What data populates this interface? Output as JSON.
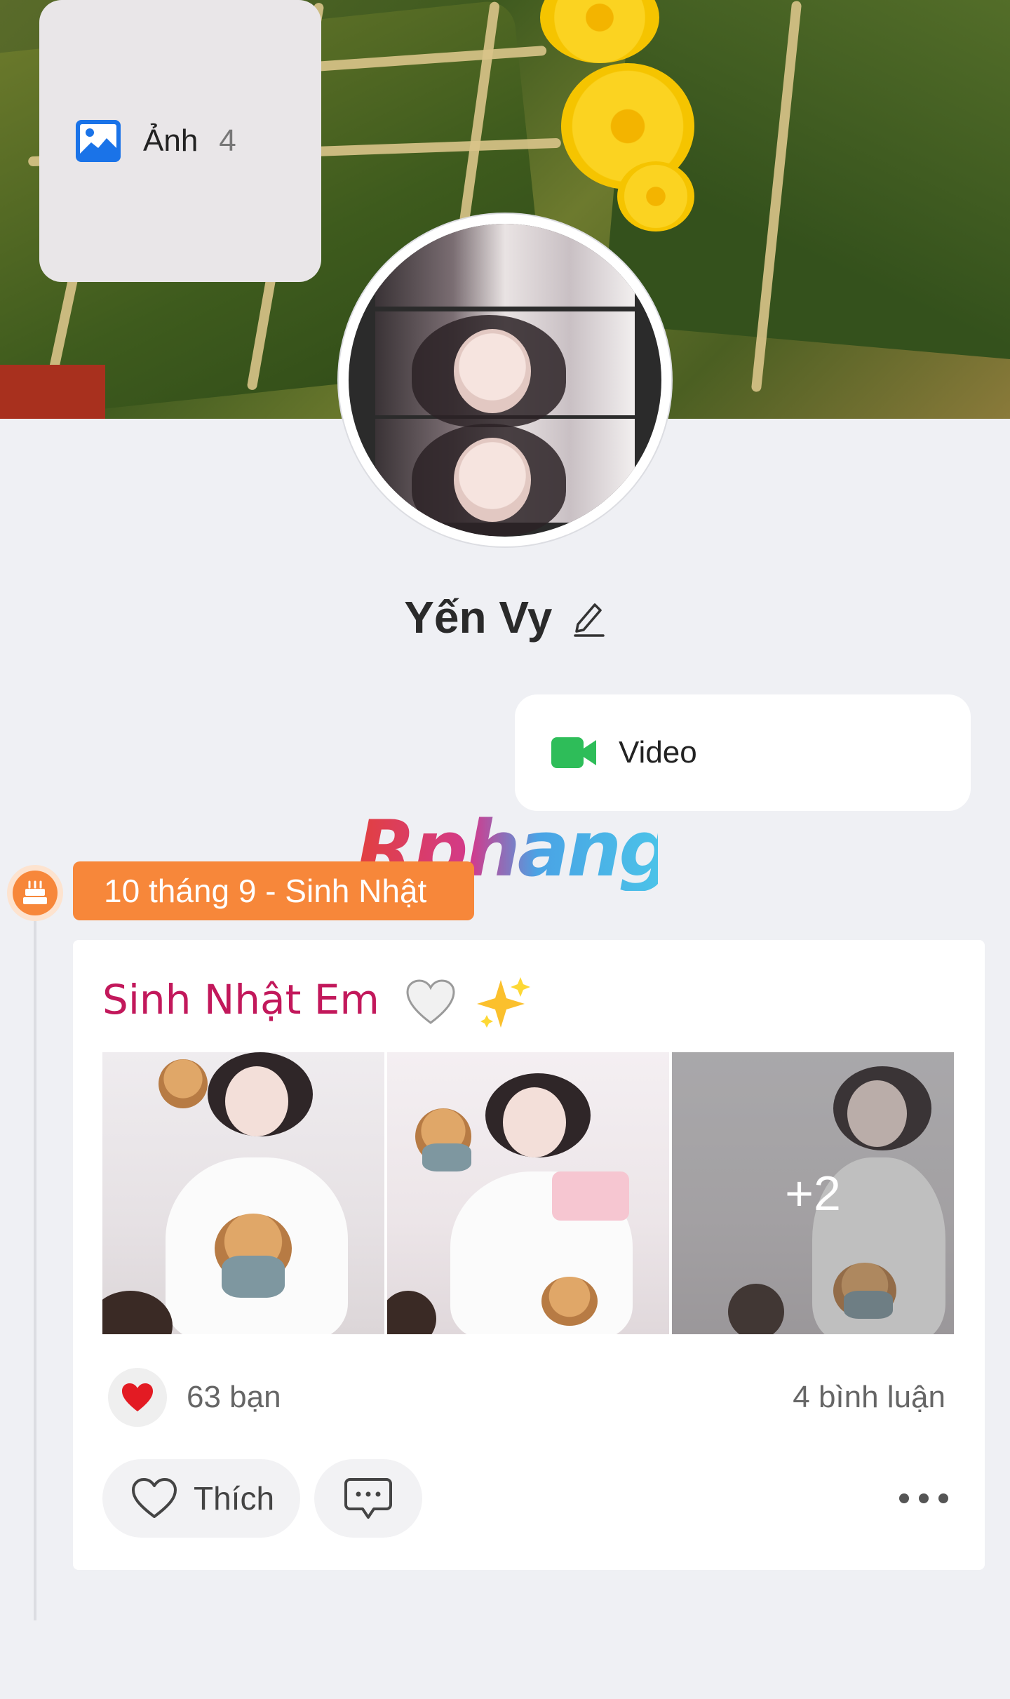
{
  "profile": {
    "name": "Yến Vy"
  },
  "media_tiles": {
    "photos_label": "Ảnh",
    "photos_count": "4",
    "video_label": "Video"
  },
  "watermark": "Rphang",
  "timeline": {
    "event_label": "10 tháng 9 - Sinh Nhật"
  },
  "post": {
    "title": "Sinh Nhật Em",
    "photo_more": "+2",
    "reactions_text": "63 bạn",
    "comments_text": "4 bình luận",
    "like_label": "Thích"
  },
  "colors": {
    "accent_orange": "#f7873a",
    "title_pink": "#c2185b",
    "photo_icon_blue": "#1a73e8",
    "video_icon_green": "#2ebd59",
    "heart_red": "#e31b23"
  },
  "icons": [
    "edit-pencil-icon",
    "image-icon",
    "video-camera-icon",
    "birthday-cake-icon",
    "heart-emoji-icon",
    "sparkles-emoji-icon",
    "red-heart-icon",
    "heart-outline-icon",
    "comment-bubble-icon",
    "more-dots-icon"
  ]
}
